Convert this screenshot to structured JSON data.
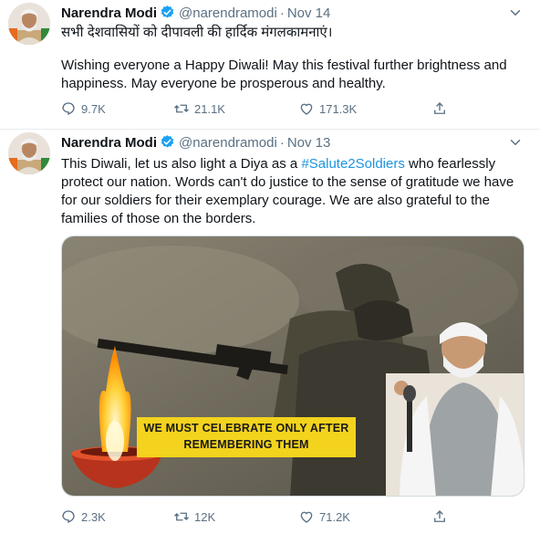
{
  "colors": {
    "link": "#1b95e0",
    "muted": "#5b7083",
    "verified": "#1da1f2",
    "divider": "#e6ecf0",
    "banner_yellow": "#f3d31d"
  },
  "tweets": [
    {
      "author_name": "Narendra Modi",
      "handle": "@narendramodi",
      "separator": "·",
      "date": "Nov 14",
      "text_hindi": "सभी देशवासियों को दीपावली की हार्दिक मंगलकामनाएं।",
      "text_english": "Wishing everyone a Happy Diwali! May this festival further brightness and happiness. May everyone be prosperous and healthy.",
      "stats": {
        "replies": "9.7K",
        "retweets": "21.1K",
        "likes": "171.3K"
      }
    },
    {
      "author_name": "Narendra Modi",
      "handle": "@narendramodi",
      "separator": "·",
      "date": "Nov 13",
      "text_before": "This Diwali, let us also light a Diya as a ",
      "hashtag": "#Salute2Soldiers",
      "text_after": " who fearlessly protect our nation. Words can't do justice to the sense of gratitude we have for our soldiers for their exemplary courage. We are also grateful to the families of those on the borders.",
      "media_banner": [
        "WE MUST CELEBRATE ONLY AFTER",
        "REMEMBERING THEM"
      ],
      "stats": {
        "replies": "2.3K",
        "retweets": "12K",
        "likes": "71.2K"
      }
    }
  ],
  "icons": [
    "verified-badge-icon",
    "caret-down-icon",
    "reply-icon",
    "retweet-icon",
    "like-icon",
    "share-icon"
  ]
}
